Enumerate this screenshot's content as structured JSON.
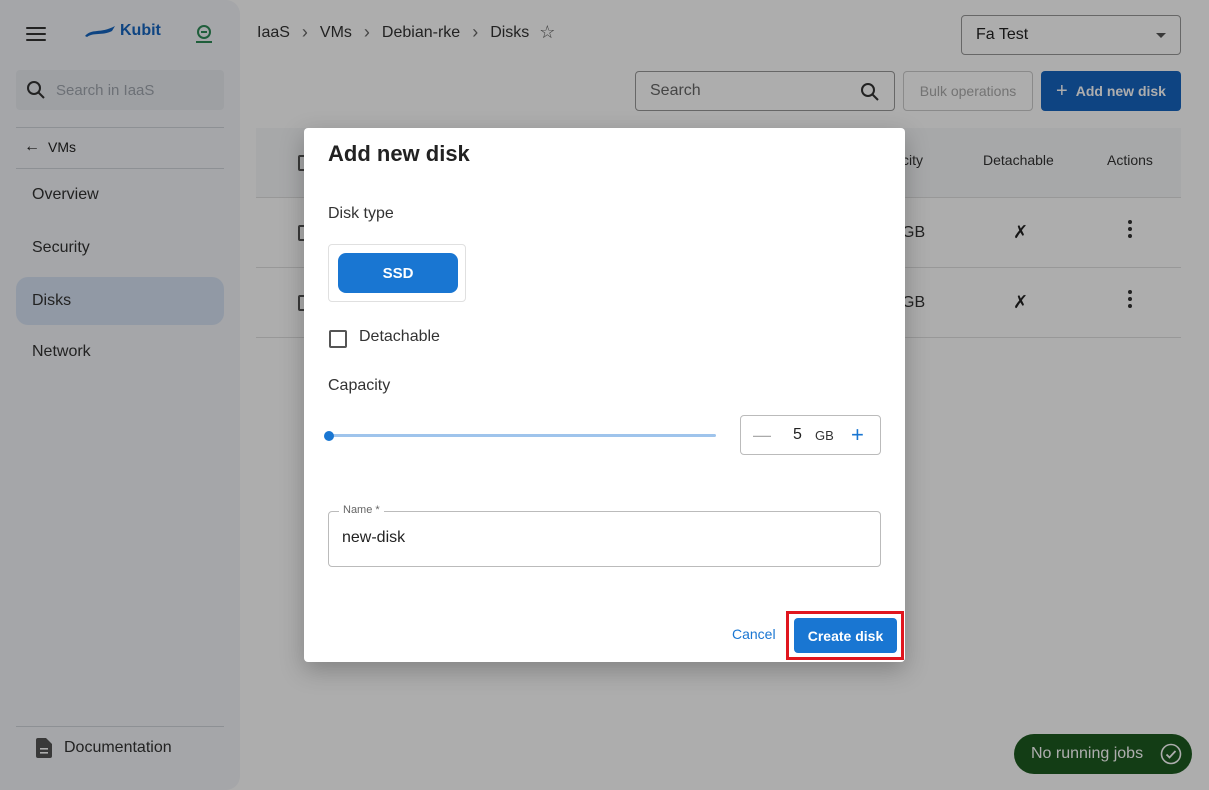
{
  "app": {
    "brand_name": "Kubit"
  },
  "sidebar": {
    "search_placeholder": "Search in IaaS",
    "back_label": "VMs",
    "items": [
      {
        "label": "Overview"
      },
      {
        "label": "Security"
      },
      {
        "label": "Disks",
        "active": true
      },
      {
        "label": "Network"
      }
    ],
    "documentation_label": "Documentation"
  },
  "header": {
    "breadcrumb": [
      "IaaS",
      "VMs",
      "Debian-rke",
      "Disks"
    ],
    "project_selected": "Fa Test"
  },
  "toolbar": {
    "search_placeholder": "Search",
    "bulk_label": "Bulk operations",
    "add_label": "Add new disk"
  },
  "table": {
    "headers": {
      "capacity_partial": "city",
      "detachable": "Detachable",
      "actions": "Actions"
    },
    "rows": [
      {
        "capacity_partial": "GB",
        "detachable_mark": "✗"
      },
      {
        "capacity_partial": "GB",
        "detachable_mark": "✗"
      }
    ]
  },
  "dialog": {
    "title": "Add new disk",
    "disk_type_label": "Disk type",
    "disk_type_option": "SSD",
    "detachable_label": "Detachable",
    "detachable_checked": false,
    "capacity_label": "Capacity",
    "capacity_value": "5",
    "capacity_unit": "GB",
    "capacity_slider_fraction": 0.0,
    "name_label": "Name *",
    "name_value": "new-disk",
    "cancel_label": "Cancel",
    "create_label": "Create disk"
  },
  "jobs": {
    "label": "No running jobs"
  },
  "colors": {
    "primary": "#1976d2",
    "brand": "#1565c0",
    "jobs_bg": "#1d5a1f",
    "highlight": "#e0161e"
  }
}
